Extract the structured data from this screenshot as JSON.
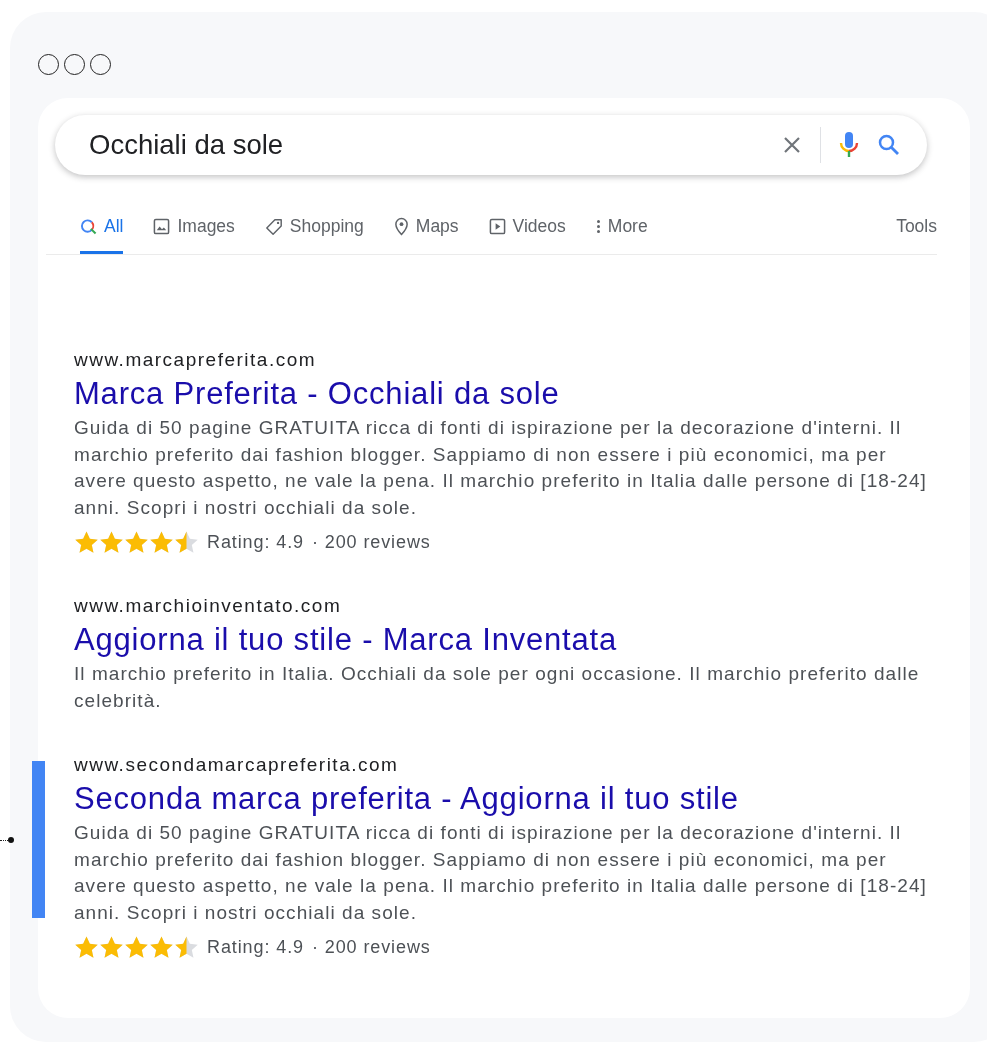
{
  "search": {
    "value": "Occhiali da sole"
  },
  "tabs": [
    {
      "label": "All",
      "selected": true
    },
    {
      "label": "Images",
      "selected": false
    },
    {
      "label": "Shopping",
      "selected": false
    },
    {
      "label": "Maps",
      "selected": false
    },
    {
      "label": "Videos",
      "selected": false
    },
    {
      "label": "More",
      "selected": false
    }
  ],
  "tools": "Tools",
  "results": [
    {
      "url": "www.marcapreferita.com",
      "title": "Marca Preferita - Occhiali da sole",
      "snippet": "Guida di 50 pagine GRATUITA ricca di fonti di ispirazione per la decorazione d'interni. Il marchio preferito dai fashion blogger. Sappiamo di non essere i più economici, ma per avere questo aspetto, ne vale la pena. Il marchio preferito in Italia dalle persone di [18-24] anni. Scopri i nostri occhiali da sole.",
      "highlighted": false,
      "stars": 4.5,
      "rating": "Rating: 4.9",
      "reviews": "· 200 reviews"
    },
    {
      "url": "www.marchioinventato.com",
      "title": "Aggiorna il tuo stile -  Marca Inventata",
      "snippet": "Il marchio preferito in Italia. Occhiali da sole per ogni occasione. Il marchio preferito dalle celebrità.",
      "highlighted": false
    },
    {
      "url": "www.secondamarcapreferita.com",
      "title": "Seconda marca preferita - Aggiorna il tuo stile",
      "snippet": "Guida di 50 pagine GRATUITA ricca di fonti di ispirazione per la decorazione d'interni. Il marchio preferito dai fashion blogger. Sappiamo di non essere i più economici, ma per avere questo aspetto, ne vale la pena. Il marchio preferito in Italia dalle persone di [18-24] anni. Scopri i nostri occhiali da sole.",
      "highlighted": true,
      "stars": 4.5,
      "rating": "Rating: 4.9",
      "reviews": "· 200 reviews"
    }
  ]
}
